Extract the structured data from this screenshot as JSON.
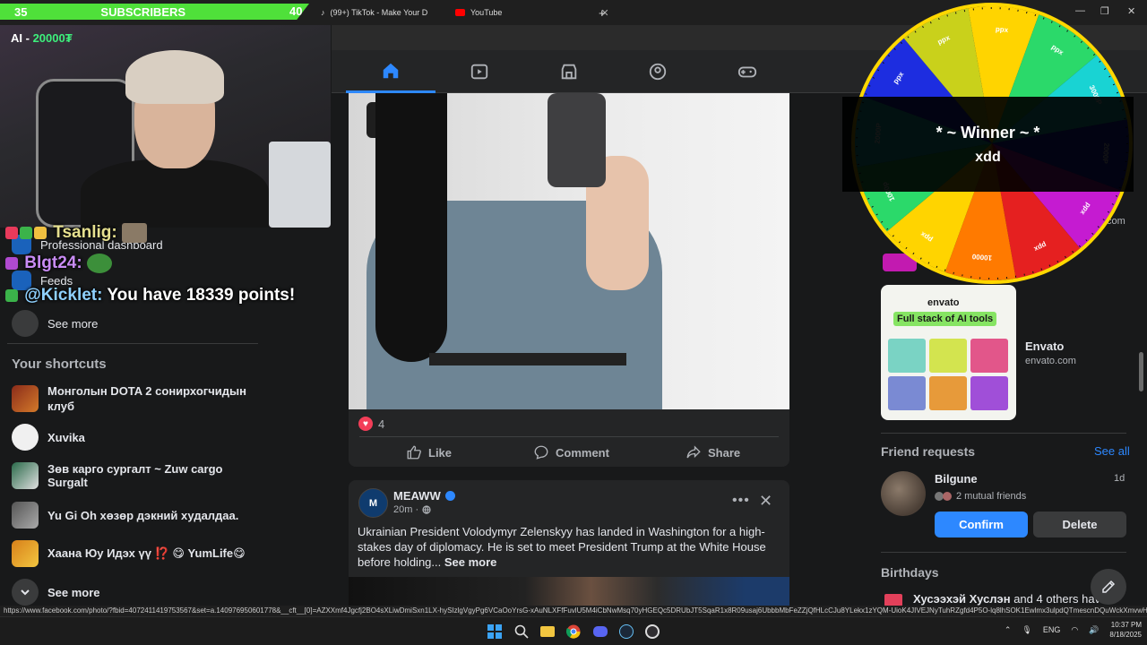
{
  "browser": {
    "tabs": [
      {
        "label": "(99+) TikTok - Make Your D"
      },
      {
        "label": "YouTube"
      }
    ],
    "new_tab": "+",
    "status_url": "https://www.facebook.com/photo/?fbid=4072411419753567&set=a.140976950601778&__cft__[0]=AZXXmf4Jgcfj2BO4sXLiwDmiSxn1LX-hySIzlgVgyPg6VCaOoYrsG-xAuNLXFfFuvlU5M4iCbNwMsq70yHGEQc5DRUbJT5SqaR1x8R09usaj6UbbbMbFeZZjQfHLcCJu8YLekx1zYQM-UioK4JIVEJNyTuhRZgfd4P5O-lq8lhSOK1Ewlmx3ulpdQTmescnDQuWckXmvwHa7F..."
  },
  "stream": {
    "sub_goal_current": "35",
    "sub_goal_label": "SUBSCRIBERS",
    "sub_goal_target": "40",
    "ai_label": "AI - ",
    "ai_amount": "20000₮"
  },
  "chat": [
    {
      "name": "Tsanlig:",
      "message": ""
    },
    {
      "name": "Blgt24:",
      "message": ""
    },
    {
      "name": "@Kicklet:",
      "message": "You have 18339 points!"
    }
  ],
  "left_sidebar": {
    "partial_item_1": "Professional dashboard",
    "partial_item_2": "Feeds",
    "see_more_top": "See more",
    "shortcuts_title": "Your shortcuts",
    "shortcuts": [
      {
        "label": "Монголын DOTA 2 сонирхогчидын клуб"
      },
      {
        "label": "Xuvika"
      },
      {
        "label": "Зөв карго сургалт ~ Zuw cargo Surgalt"
      },
      {
        "label": "Yu Gi Oh хөзөр дэкний худалдаа."
      },
      {
        "label": "Хаана Юу Идэх үү ⁉️ 😋 YumLife😋"
      }
    ],
    "see_more_bottom": "See more"
  },
  "post1": {
    "reaction_count": "4",
    "like_label": "Like",
    "comment_label": "Comment",
    "share_label": "Share"
  },
  "post2": {
    "author": "MEAWW",
    "time": "20m ·",
    "text": "Ukrainian President Volodymyr Zelenskyy has landed in Washington for a high-stakes day of diplomacy. He is set to meet President Trump at the White House before holding... ",
    "see_more": "See more",
    "avatar_text": "M"
  },
  "right_sidebar": {
    "partial_url": ".com",
    "sponsor_name": "Envato",
    "sponsor_url": "envato.com",
    "ad_logo": "envato",
    "ad_tagline": "Full stack of AI tools",
    "friend_requests_title": "Friend requests",
    "see_all": "See all",
    "request": {
      "name": "Bilgune",
      "time": "1d",
      "mutual": "2 mutual friends",
      "confirm": "Confirm",
      "delete": "Delete"
    },
    "birthdays_title": "Birthdays",
    "birthday_name": "Хусээхэй Хуслэн",
    "birthday_rest": " and 4 others have"
  },
  "wheel": {
    "banner_title": "* ~ Winner ~ *",
    "winner": "xdd",
    "segments": [
      "ppx",
      "ppx",
      "3000P",
      "2000P",
      "ppx",
      "ppx",
      "10000",
      "ppx",
      "1000p",
      "2000P",
      "ppx",
      "ppx"
    ],
    "colors": [
      "#ffd400",
      "#2bd96a",
      "#19d3d3",
      "#1d2de0",
      "#c51bd1",
      "#e52020",
      "#ff7a00",
      "#ffd400",
      "#2bd96a",
      "#19d3d3",
      "#1d2de0",
      "#c9d11b"
    ]
  },
  "taskbar": {
    "language": "ENG",
    "time": "10:37 PM",
    "date": "8/18/2025"
  }
}
